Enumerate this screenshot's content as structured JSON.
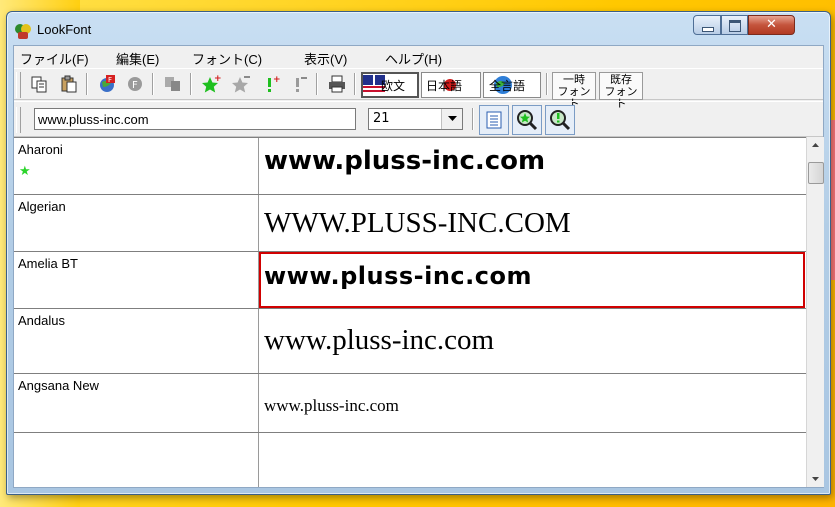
{
  "window": {
    "title": "LookFont"
  },
  "menu": [
    "ファイル(F)",
    "編集(E)",
    "フォント(C)",
    "表示(V)",
    "ヘルプ(H)"
  ],
  "toolbar": {
    "lang_european": "欧文",
    "lang_japanese": "日本語",
    "lang_all": "全言語",
    "temp_font": [
      "一時",
      "フォント"
    ],
    "existing_font": [
      "既存",
      "フォント"
    ]
  },
  "search": {
    "text": "www.pluss-inc.com",
    "size": "21"
  },
  "fonts": [
    {
      "name": "Aharoni",
      "sample": "www.pluss-inc.com",
      "favorite": true
    },
    {
      "name": "Algerian",
      "sample": "WWW.PLUSS-INC.COM",
      "favorite": false
    },
    {
      "name": "Amelia BT",
      "sample": "www.pluss-inc.com",
      "favorite": false,
      "selected": true
    },
    {
      "name": "Andalus",
      "sample": "www.pluss-inc.com",
      "favorite": false
    },
    {
      "name": "Angsana New",
      "sample": "www.pluss-inc.com",
      "favorite": false
    }
  ],
  "colors": {
    "selection": "#d00000",
    "favorite_star": "#2bd42b",
    "background": "#ffd400"
  }
}
